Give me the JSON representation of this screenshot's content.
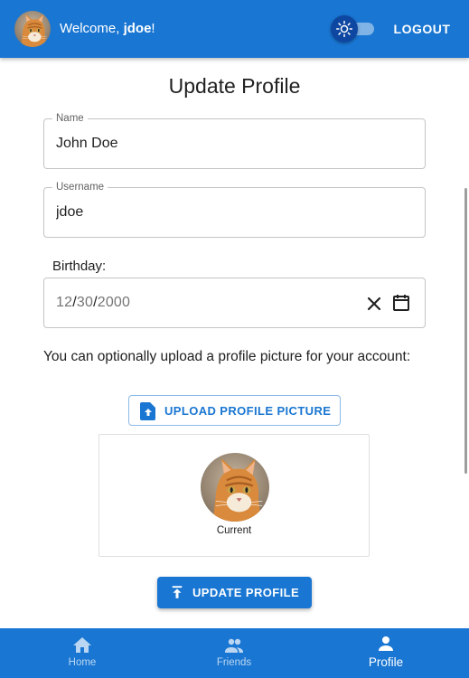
{
  "header": {
    "welcome_prefix": "Welcome, ",
    "username": "jdoe",
    "welcome_suffix": "!",
    "theme_toggle_icon": "sun-icon",
    "logout_label": "LOGOUT"
  },
  "colors": {
    "primary": "#1976d2",
    "toggle_thumb": "#0d47a1"
  },
  "form": {
    "title": "Update Profile",
    "name": {
      "label": "Name",
      "value": "John Doe"
    },
    "username": {
      "label": "Username",
      "value": "jdoe"
    },
    "birthday": {
      "label": "Birthday:",
      "month": "12",
      "day": "30",
      "year": "2000",
      "separator": "/"
    },
    "upload_text": "You can optionally upload a profile picture for your account:",
    "upload_button_label": "UPLOAD PROFILE PICTURE",
    "current_caption": "Current",
    "submit_label": "UPDATE PROFILE"
  },
  "bottom_nav": {
    "items": [
      {
        "label": "Home",
        "icon": "home-icon",
        "active": false
      },
      {
        "label": "Friends",
        "icon": "people-icon",
        "active": false
      },
      {
        "label": "Profile",
        "icon": "person-icon",
        "active": true
      }
    ]
  }
}
